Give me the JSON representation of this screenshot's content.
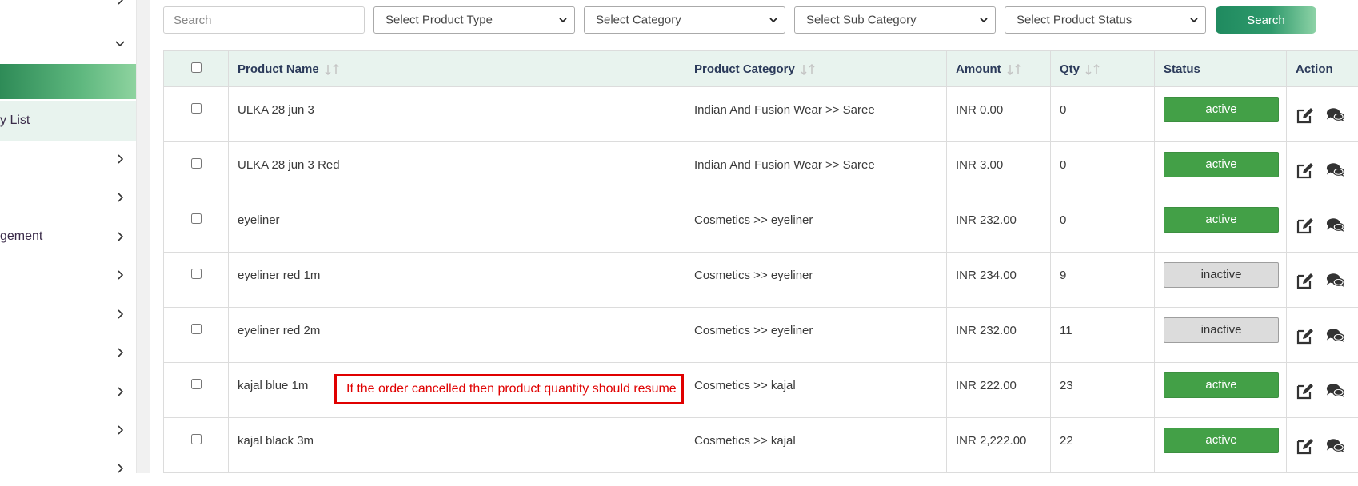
{
  "sidebar": {
    "items": [
      {
        "label": ""
      },
      {
        "label": ""
      },
      {
        "label": ""
      },
      {
        "label": "y List"
      },
      {
        "label": ""
      },
      {
        "label": ""
      },
      {
        "label": "gement"
      },
      {
        "label": ""
      },
      {
        "label": ""
      },
      {
        "label": ""
      },
      {
        "label": ""
      },
      {
        "label": ""
      },
      {
        "label": ""
      }
    ]
  },
  "filters": {
    "search_placeholder": "Search",
    "product_type": "Select Product Type",
    "category": "Select Category",
    "sub_category": "Select Sub Category",
    "product_status": "Select Product Status",
    "search_button": "Search"
  },
  "table": {
    "headers": {
      "product_name": "Product Name",
      "product_category": "Product Category",
      "amount": "Amount",
      "qty": "Qty",
      "status": "Status",
      "action": "Action"
    },
    "rows": [
      {
        "name": "ULKA 28 jun 3",
        "category": "Indian And Fusion Wear >> Saree",
        "amount": "INR 0.00",
        "qty": "0",
        "status": "active"
      },
      {
        "name": "ULKA 28 jun 3 Red",
        "category": "Indian And Fusion Wear >> Saree",
        "amount": "INR 3.00",
        "qty": "0",
        "status": "active"
      },
      {
        "name": "eyeliner",
        "category": "Cosmetics >> eyeliner",
        "amount": "INR 232.00",
        "qty": "0",
        "status": "active"
      },
      {
        "name": "eyeliner red 1m",
        "category": "Cosmetics >> eyeliner",
        "amount": "INR 234.00",
        "qty": "9",
        "status": "inactive"
      },
      {
        "name": "eyeliner red 2m",
        "category": "Cosmetics >> eyeliner",
        "amount": "INR 232.00",
        "qty": "11",
        "status": "inactive"
      },
      {
        "name": "kajal blue 1m",
        "category": "Cosmetics >> kajal",
        "amount": "INR 222.00",
        "qty": "23",
        "status": "active"
      },
      {
        "name": "kajal black 3m",
        "category": "Cosmetics >> kajal",
        "amount": "INR 2,222.00",
        "qty": "22",
        "status": "active"
      }
    ]
  },
  "annotation": {
    "text": "If the order cancelled then product quantity should resume"
  },
  "icons": {
    "edit": "edit-icon",
    "comment": "comments-icon",
    "sort": "sort-icon",
    "chevron": "chevron-icon"
  },
  "colors": {
    "accent": "#2e8b57",
    "active": "#43a047",
    "inactive": "#dcdcdc",
    "header_bg": "#e8f3ee",
    "annotation": "#e00000"
  }
}
